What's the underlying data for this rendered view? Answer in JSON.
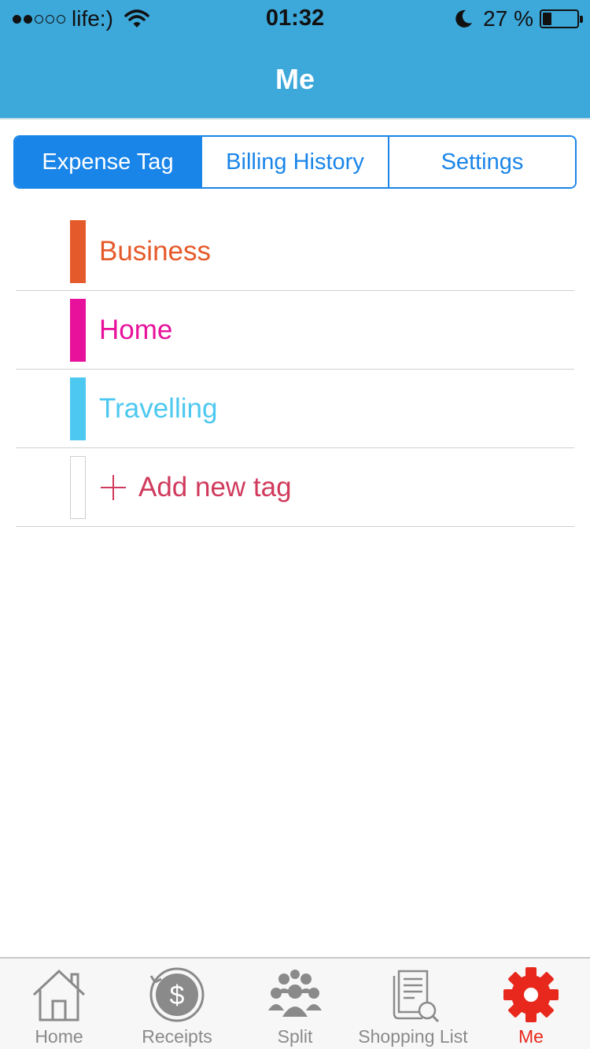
{
  "status_bar": {
    "carrier": "life:)",
    "time": "01:32",
    "battery_text": "27 %",
    "battery_level": 0.27,
    "signal_strength": 2,
    "signal_total": 5
  },
  "header": {
    "title": "Me",
    "background_color": "#3da8da"
  },
  "segmented_control": {
    "accent_color": "#1a85e8",
    "segments": [
      {
        "label": "Expense Tag",
        "active": true
      },
      {
        "label": "Billing History",
        "active": false
      },
      {
        "label": "Settings",
        "active": false
      }
    ]
  },
  "tags": [
    {
      "label": "Business",
      "color": "#e55a2a"
    },
    {
      "label": "Home",
      "color": "#e8119b"
    },
    {
      "label": "Travelling",
      "color": "#4dc8f0"
    }
  ],
  "add_tag": {
    "label": "Add new tag",
    "color": "#d03a5c",
    "icon": "plus-icon"
  },
  "tab_bar": {
    "items": [
      {
        "label": "Home",
        "icon": "house-icon",
        "active": false
      },
      {
        "label": "Receipts",
        "icon": "dollar-coin-icon",
        "active": false
      },
      {
        "label": "Split",
        "icon": "group-icon",
        "active": false
      },
      {
        "label": "Shopping List",
        "icon": "shopping-list-icon",
        "active": false
      },
      {
        "label": "Me",
        "icon": "gear-icon",
        "active": true
      }
    ],
    "active_color": "#e8281c",
    "inactive_color": "#8a8a8a"
  }
}
